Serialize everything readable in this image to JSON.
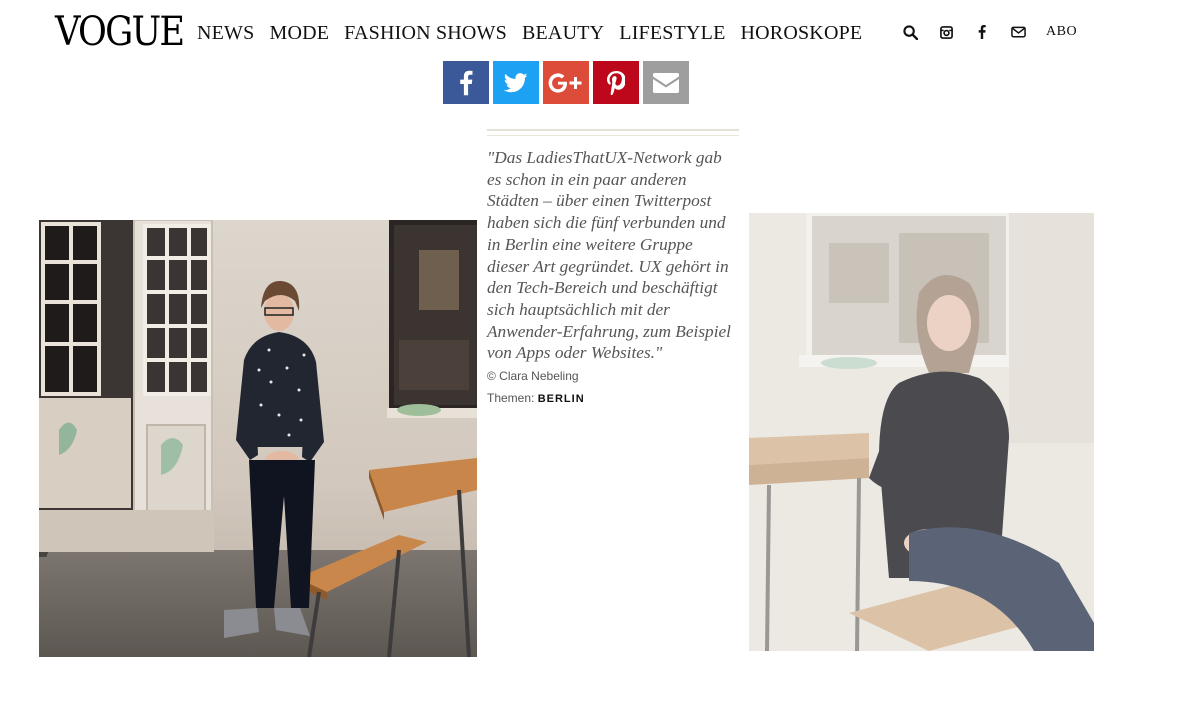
{
  "header": {
    "logo": "VOGUE",
    "nav": [
      "NEWS",
      "MODE",
      "FASHION SHOWS",
      "BEAUTY",
      "LIFESTYLE",
      "HOROSKOPE"
    ],
    "icons": [
      "search-icon",
      "instagram-icon",
      "facebook-icon",
      "mail-icon"
    ],
    "abo_label": "ABO"
  },
  "share": {
    "buttons": [
      "facebook",
      "twitter",
      "google-plus",
      "pinterest",
      "email"
    ],
    "colors": {
      "facebook": "#3b5998",
      "twitter": "#1da1f2",
      "google_plus": "#dd4b39",
      "pinterest": "#bd081c",
      "email": "#9e9e9e"
    }
  },
  "article": {
    "caption": "\"Das LadiesThatUX-Network gab es schon in ein paar anderen Städten – über einen Twitterpost haben sich die fünf verbunden und in Berlin eine weitere Gruppe dieser Art gegründet. UX gehört in den Tech-Bereich und beschäftigt sich hauptsächlich mit der Anwender-Erfahrung, zum Beispiel von Apps oder Websites.\"",
    "credit": "© Clara Nebeling",
    "themes_label": "Themen:",
    "theme_tag": "BERLIN"
  }
}
